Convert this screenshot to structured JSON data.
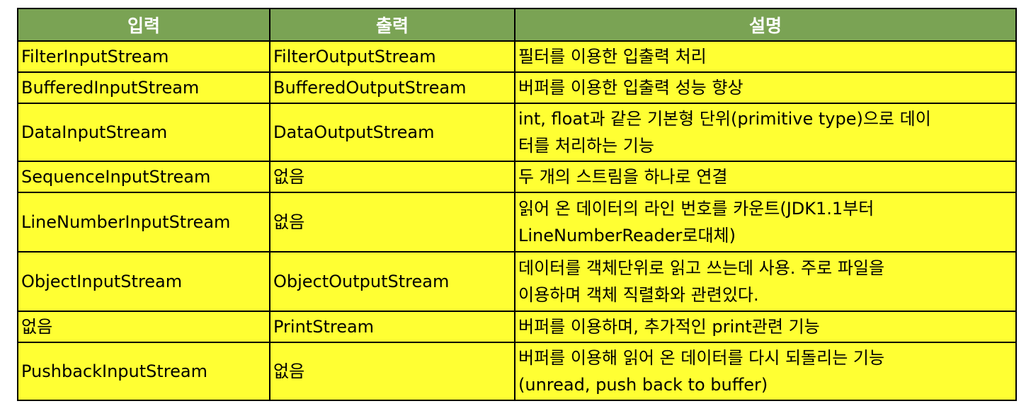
{
  "colors": {
    "header_bg": "#7aa354",
    "header_text": "#ffffff",
    "cell_bg": "#ffff33",
    "border": "#000000"
  },
  "table": {
    "headers": [
      "입력",
      "출력",
      "설명"
    ],
    "rows": [
      {
        "input": "FilterInputStream",
        "output": "FilterOutputStream",
        "desc": [
          "필터를 이용한 입출력 처리"
        ]
      },
      {
        "input": "BufferedInputStream",
        "output": "BufferedOutputStream",
        "desc": [
          "버퍼를 이용한 입출력 성능 향상"
        ]
      },
      {
        "input": "DataInputStream",
        "output": "DataOutputStream",
        "desc": [
          "int, float과 같은 기본형 단위(primitive type)으로 데이",
          "터를 처리하는 기능"
        ]
      },
      {
        "input": "SequenceInputStream",
        "output": "없음",
        "desc": [
          "두 개의 스트림을 하나로 연결"
        ]
      },
      {
        "input": "LineNumberInputStream",
        "output": "없음",
        "desc": [
          "읽어 온 데이터의 라인 번호를 카운트(JDK1.1부터",
          "LineNumberReader로대체)"
        ]
      },
      {
        "input": "ObjectInputStream",
        "output": "ObjectOutputStream",
        "desc": [
          "데이터를 객체단위로 읽고 쓰는데 사용. 주로 파일을",
          "이용하며 객체 직렬화와 관련있다."
        ]
      },
      {
        "input": "없음",
        "output": "PrintStream",
        "desc": [
          "버퍼를 이용하며, 추가적인 print관련 기능"
        ]
      },
      {
        "input": "PushbackInputStream",
        "output": "없음",
        "desc": [
          "버퍼를 이용해 읽어 온 데이터를 다시 되돌리는 기능",
          "(unread, push back to buffer)"
        ]
      }
    ]
  }
}
